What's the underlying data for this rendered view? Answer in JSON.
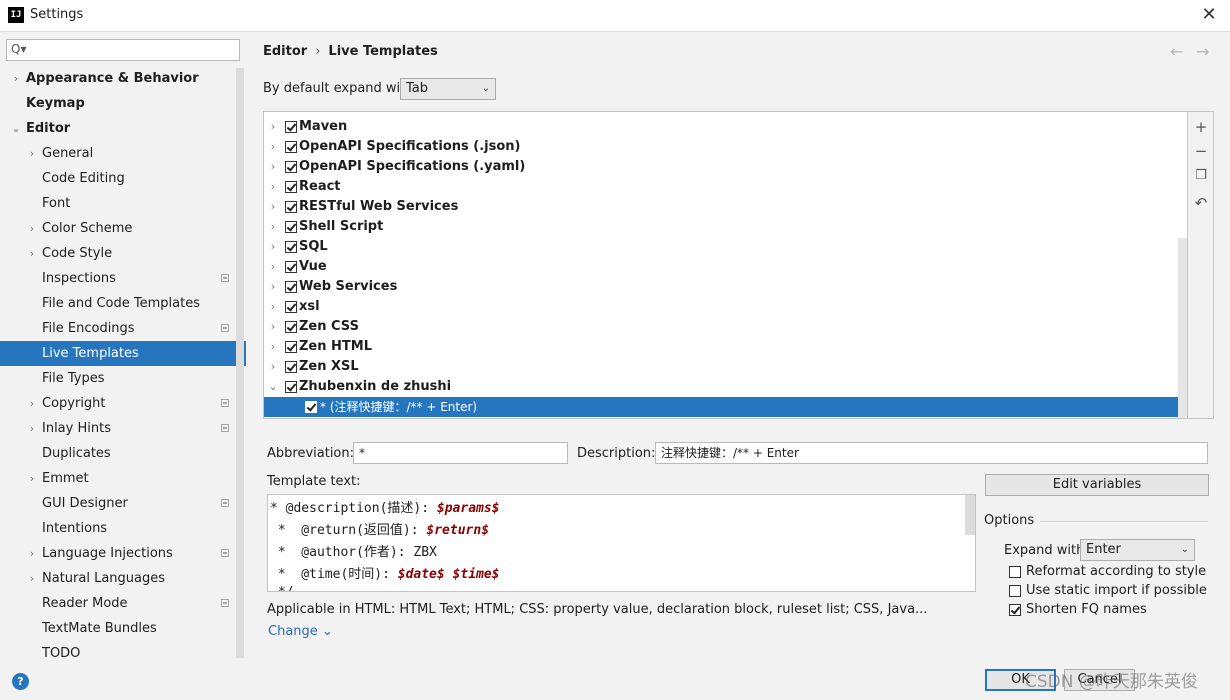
{
  "window": {
    "title": "Settings",
    "app_icon": "IJ"
  },
  "sidebar": {
    "search_placeholder": "Q▾",
    "items": [
      {
        "label": "Appearance & Behavior",
        "arrow": "›",
        "bold": true,
        "level": 0
      },
      {
        "label": "Keymap",
        "arrow": "",
        "bold": true,
        "level": 0
      },
      {
        "label": "Editor",
        "arrow": "⌄",
        "bold": true,
        "level": 0
      },
      {
        "label": "General",
        "arrow": "›",
        "level": 1
      },
      {
        "label": "Code Editing",
        "arrow": "",
        "level": 1
      },
      {
        "label": "Font",
        "arrow": "",
        "level": 1
      },
      {
        "label": "Color Scheme",
        "arrow": "›",
        "level": 1
      },
      {
        "label": "Code Style",
        "arrow": "›",
        "level": 1
      },
      {
        "label": "Inspections",
        "arrow": "",
        "level": 1,
        "marker": true
      },
      {
        "label": "File and Code Templates",
        "arrow": "",
        "level": 1
      },
      {
        "label": "File Encodings",
        "arrow": "",
        "level": 1,
        "marker": true
      },
      {
        "label": "Live Templates",
        "arrow": "",
        "level": 1,
        "selected": true
      },
      {
        "label": "File Types",
        "arrow": "",
        "level": 1
      },
      {
        "label": "Copyright",
        "arrow": "›",
        "level": 1,
        "marker": true
      },
      {
        "label": "Inlay Hints",
        "arrow": "›",
        "level": 1,
        "marker": true
      },
      {
        "label": "Duplicates",
        "arrow": "",
        "level": 1
      },
      {
        "label": "Emmet",
        "arrow": "›",
        "level": 1
      },
      {
        "label": "GUI Designer",
        "arrow": "",
        "level": 1,
        "marker": true
      },
      {
        "label": "Intentions",
        "arrow": "",
        "level": 1
      },
      {
        "label": "Language Injections",
        "arrow": "›",
        "level": 1,
        "marker": true
      },
      {
        "label": "Natural Languages",
        "arrow": "›",
        "level": 1
      },
      {
        "label": "Reader Mode",
        "arrow": "",
        "level": 1,
        "marker": true
      },
      {
        "label": "TextMate Bundles",
        "arrow": "",
        "level": 1
      },
      {
        "label": "TODO",
        "arrow": "",
        "level": 1
      }
    ]
  },
  "breadcrumb": {
    "parent": "Editor",
    "sep": "›",
    "current": "Live Templates"
  },
  "nav": {
    "back": "←",
    "forward": "→"
  },
  "expand_default": {
    "label": "By default expand with",
    "value": "Tab"
  },
  "tree": {
    "rows": [
      {
        "label": "Maven",
        "arrow": "›",
        "checked": true
      },
      {
        "label": "OpenAPI Specifications (.json)",
        "arrow": "›",
        "checked": true
      },
      {
        "label": "OpenAPI Specifications (.yaml)",
        "arrow": "›",
        "checked": true
      },
      {
        "label": "React",
        "arrow": "›",
        "checked": true
      },
      {
        "label": "RESTful Web Services",
        "arrow": "›",
        "checked": true
      },
      {
        "label": "Shell Script",
        "arrow": "›",
        "checked": true
      },
      {
        "label": "SQL",
        "arrow": "›",
        "checked": true
      },
      {
        "label": "Vue",
        "arrow": "›",
        "checked": true
      },
      {
        "label": "Web Services",
        "arrow": "›",
        "checked": true
      },
      {
        "label": "xsl",
        "arrow": "›",
        "checked": true
      },
      {
        "label": "Zen CSS",
        "arrow": "›",
        "checked": true
      },
      {
        "label": "Zen HTML",
        "arrow": "›",
        "checked": true
      },
      {
        "label": "Zen XSL",
        "arrow": "›",
        "checked": true
      },
      {
        "label": "Zhubenxin de zhushi",
        "arrow": "⌄",
        "checked": true
      },
      {
        "label": "* (注释快捷键：/** + Enter)",
        "arrow": "",
        "checked": true,
        "selected": true,
        "child": true
      }
    ],
    "toolbar": {
      "add": "+",
      "remove": "−",
      "copy": "❐",
      "restore": "↶"
    }
  },
  "abbreviation": {
    "label": "Abbreviation:",
    "value": "*"
  },
  "description": {
    "label": "Description:",
    "value": "注释快捷键：/** + Enter"
  },
  "template_text": {
    "label": "Template text:",
    "lines": [
      {
        "pre": "* @description(描述): ",
        "var": "$params$"
      },
      {
        "pre": " *  @return(返回值): ",
        "var": "$return$"
      },
      {
        "pre": " *  @author(作者): ZBX",
        "var": ""
      },
      {
        "pre": " *  @time(时间): ",
        "var": "$date$ $time$"
      },
      {
        "pre": " */",
        "var": ""
      }
    ]
  },
  "applicable": "Applicable in HTML: HTML Text; HTML; CSS: property value, declaration block, ruleset list; CSS, Java...",
  "change_link": "Change ⌄",
  "edit_variables": "Edit variables",
  "options": {
    "label": "Options",
    "expand_with_label": "Expand with",
    "expand_with_value": "Enter",
    "reformat": {
      "label": "Reformat according to style",
      "checked": false
    },
    "static_import": {
      "label": "Use static import if possible",
      "checked": false
    },
    "shorten_fq": {
      "label": "Shorten FQ names",
      "checked": true
    }
  },
  "buttons": {
    "ok": "OK",
    "cancel": "Cancel",
    "help": "?"
  },
  "watermark": "CSDN @昨天那朱英俊"
}
